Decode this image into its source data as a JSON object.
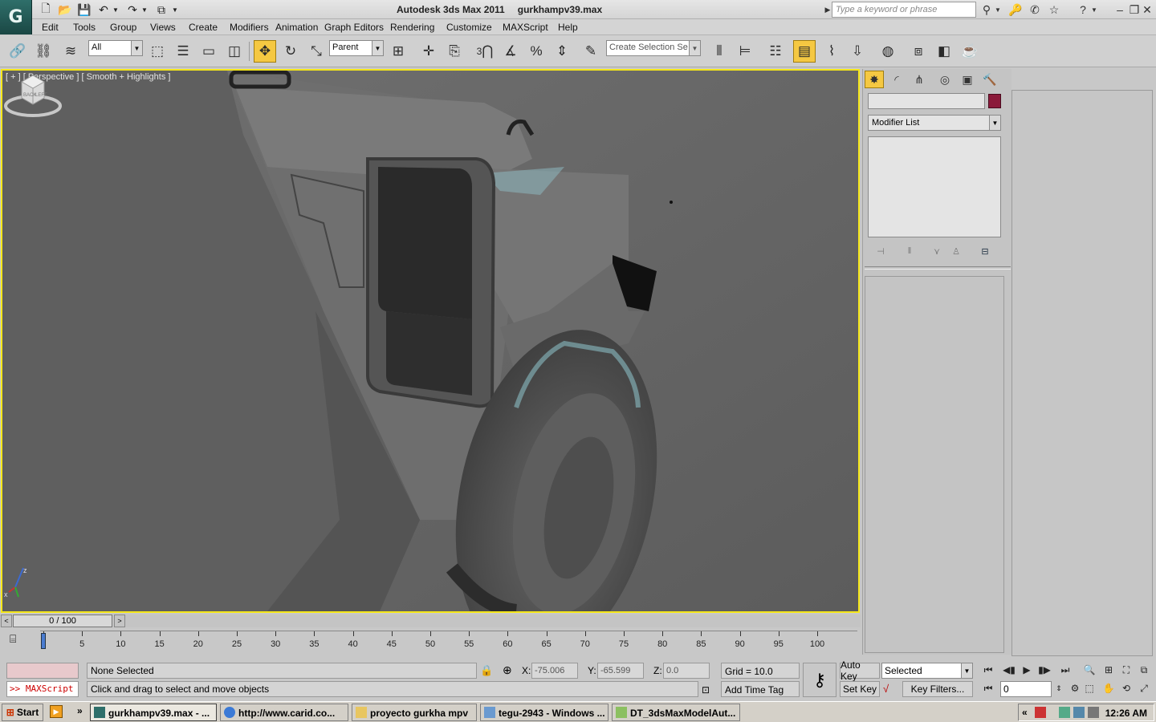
{
  "title": {
    "app": "Autodesk 3ds Max  2011",
    "file": "gurkhampv39.max",
    "search_placeholder": "Type a keyword or phrase"
  },
  "menu": [
    "Edit",
    "Tools",
    "Group",
    "Views",
    "Create",
    "Modifiers",
    "Animation",
    "Graph Editors",
    "Rendering",
    "Customize",
    "MAXScript",
    "Help"
  ],
  "toolbar": {
    "selection_filter": "All",
    "reference_coord": "Parent",
    "named_selection": "Create Selection Se",
    "snap_label": "3"
  },
  "viewport": {
    "label": "[ + ] [ Perspective ] [ Smooth + Highlights ]",
    "axis_x": "x",
    "axis_z": "z",
    "viewcube_faces": [
      "BACK",
      "LEFT"
    ],
    "active_border_color": "#f5e71a"
  },
  "command_panel": {
    "modifier_list": "Modifier List",
    "object_color": "#8b1a3a"
  },
  "time_slider": {
    "position": "0 / 100",
    "left_arrow": "<",
    "right_arrow": ">"
  },
  "trackbar": {
    "ticks": [
      "0",
      "5",
      "10",
      "15",
      "20",
      "25",
      "30",
      "35",
      "40",
      "45",
      "50",
      "55",
      "60",
      "65",
      "70",
      "75",
      "80",
      "85",
      "90",
      "95",
      "100"
    ]
  },
  "status": {
    "maxscript": ">> MAXScript",
    "selection": "None Selected",
    "prompt": "Click and drag to select and move objects",
    "x_label": "X:",
    "x_value": "-75.006",
    "y_label": "Y:",
    "y_value": "-65.599",
    "z_label": "Z:",
    "z_value": "0.0",
    "grid": "Grid = 10.0",
    "add_time_tag": "Add Time Tag",
    "auto_key": "Auto Key",
    "set_key": "Set Key",
    "key_mode": "Selected",
    "key_filters": "Key Filters...",
    "current_frame": "0"
  },
  "taskbar": {
    "start": "Start",
    "chevron": "»",
    "tray_chevron": "«",
    "clock": "12:26 AM",
    "tasks": [
      "gurkhampv39.max - ...",
      "http://www.carid.co...",
      "proyecto gurkha mpv",
      "tegu-2943 - Windows ...",
      "DT_3dsMaxModelAut..."
    ]
  }
}
